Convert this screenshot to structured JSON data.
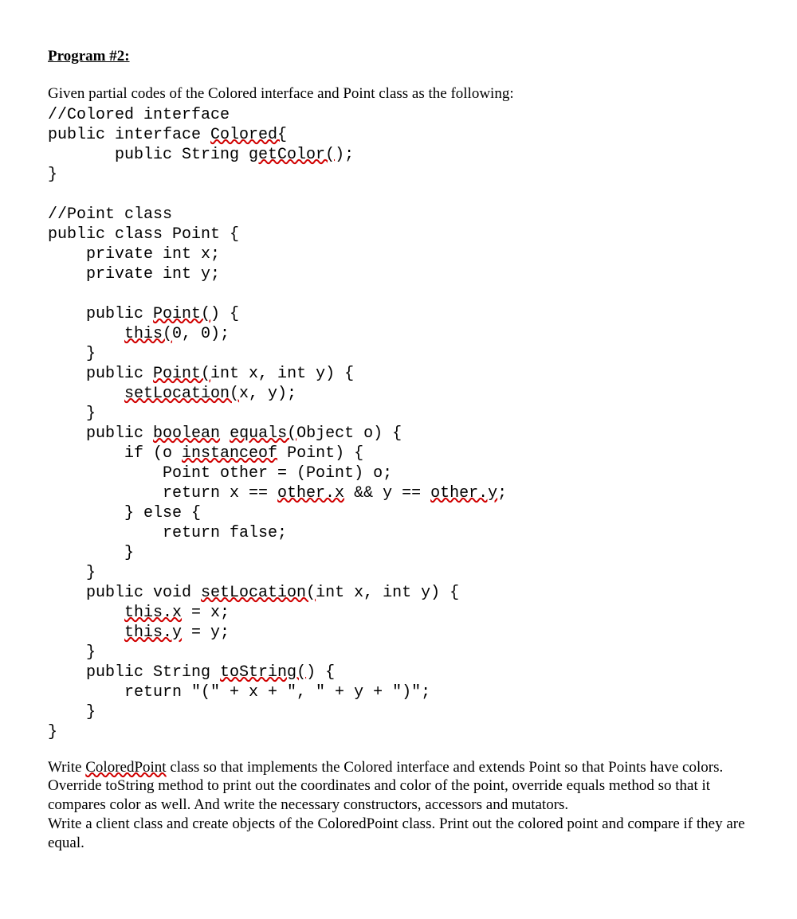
{
  "heading": "Program #2:",
  "intro": "Given partial codes of the Colored interface and Point class as the following:",
  "code": {
    "l1": "//Colored interface",
    "l2a": "public interface ",
    "l2b": "Colored{",
    "l3a": "       public String ",
    "l3b": "getColor(",
    "l3c": ");",
    "l4": "}",
    "l5": "",
    "l6": "//Point class",
    "l7": "public class Point {",
    "l8": "    private int x;",
    "l9": "    private int y;",
    "l10": "",
    "l11a": "    public ",
    "l11b": "Point(",
    "l11c": ") {",
    "l12a": "        ",
    "l12b": "this(",
    "l12c": "0, 0);",
    "l13": "    }",
    "l14a": "    public ",
    "l14b": "Point(",
    "l14c": "int x, int y) {",
    "l15a": "        ",
    "l15b": "setLocation(",
    "l15c": "x, y);",
    "l16": "    }",
    "l17a": "    public ",
    "l17b": "boolean",
    "l17c": " ",
    "l17d": "equals(",
    "l17e": "Object o) {",
    "l18a": "        if (o ",
    "l18b": "instanceof",
    "l18c": " Point) {",
    "l19": "            Point other = (Point) o;",
    "l20a": "            return x == ",
    "l20b": "other.x",
    "l20c": " && y == ",
    "l20d": "other.y",
    "l20e": ";",
    "l21": "        } else {",
    "l22": "            return false;",
    "l23": "        }",
    "l24": "    }",
    "l25a": "    public void ",
    "l25b": "setLocation(",
    "l25c": "int x, int y) {",
    "l26a": "        ",
    "l26b": "this.x",
    "l26c": " = x;",
    "l27a": "        ",
    "l27b": "this.y",
    "l27c": " = y;",
    "l28": "    }",
    "l29a": "    public String ",
    "l29b": "toString(",
    "l29c": ") {",
    "l30": "        return \"(\" + x + \", \" + y + \")\";",
    "l31": "    }",
    "l32": "}"
  },
  "outro": {
    "p1a": "Write ",
    "p1b": "ColoredPoint",
    "p1c": " class so that implements the Colored interface and extends Point so that Points have colors. Override toString method to print out the coordinates and color of the point, override equals method so that it compares color as well. And write the necessary constructors, accessors and mutators.",
    "p2": "Write a client class and create objects of the ColoredPoint class. Print out the colored point and compare if they are equal."
  }
}
